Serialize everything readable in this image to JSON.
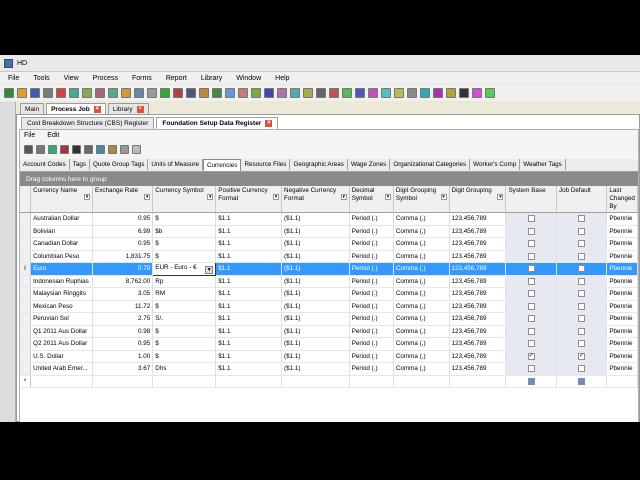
{
  "app": {
    "title": "HD"
  },
  "menu": [
    "File",
    "Tools",
    "View",
    "Process",
    "Forms",
    "Report",
    "Library",
    "Window",
    "Help"
  ],
  "doc_tabs": [
    {
      "label": "Main",
      "active": false
    },
    {
      "label": "Process Job",
      "active": true
    },
    {
      "label": "Library",
      "active": false
    }
  ],
  "sub_tabs": [
    {
      "label": "Cost Breakdown Structure (CBS) Register",
      "active": false
    },
    {
      "label": "Foundation Setup Data Register",
      "active": true
    }
  ],
  "panel_menu": [
    "File",
    "Edit"
  ],
  "category_tabs": [
    "Account Codes",
    "Tags",
    "Quote Group Tags",
    "Units of Measure",
    "Currencies",
    "Resource Files",
    "Geographic Areas",
    "Wage Zones",
    "Organizational Categories",
    "Worker's Comp",
    "Weather Tags"
  ],
  "active_category": "Currencies",
  "group_area_text": "Drag columns here to group",
  "columns": [
    "Currency Name",
    "Exchange Rate",
    "Currency Symbol",
    "Positive Currency Format",
    "Negative Currency Format",
    "Decimal Symbol",
    "Digit Grouping Symbol",
    "Digit Grouping",
    "System Base",
    "Job Default",
    "Last Changed By"
  ],
  "rows": [
    {
      "name": "Australian Dollar",
      "rate": "0.95",
      "symbol": "$",
      "pos": "$1.1",
      "neg": "($1.1)",
      "dec": "Period (.)",
      "grp": "Comma (,)",
      "digits": "123,456,789",
      "sys": false,
      "job": false,
      "by": "Pbennie"
    },
    {
      "name": "Bolivian",
      "rate": "6.99",
      "symbol": "$b",
      "pos": "$1.1",
      "neg": "($1.1)",
      "dec": "Period (.)",
      "grp": "Comma (,)",
      "digits": "123,456,789",
      "sys": false,
      "job": false,
      "by": "Pbennie"
    },
    {
      "name": "Canadian Dollar",
      "rate": "0.95",
      "symbol": "$",
      "pos": "$1.1",
      "neg": "($1.1)",
      "dec": "Period (.)",
      "grp": "Comma (,)",
      "digits": "123,456,789",
      "sys": false,
      "job": false,
      "by": "Pbennie"
    },
    {
      "name": "Columbian Peso",
      "rate": "1,831.75",
      "symbol": "$",
      "pos": "$1.1",
      "neg": "($1.1)",
      "dec": "Period (.)",
      "grp": "Comma (,)",
      "digits": "123,456,789",
      "sys": false,
      "job": false,
      "by": "Pbennie"
    },
    {
      "name": "Euro",
      "rate": "0.70",
      "symbol": "EUR - Euro - €",
      "pos": "$1.1",
      "neg": "($1.1)",
      "dec": "Period (.)",
      "grp": "Comma (,)",
      "digits": "123,456,789",
      "sys": false,
      "job": false,
      "by": "Pbennie",
      "selected": true
    },
    {
      "name": "Indonesian Ruphias",
      "rate": "8,762.00",
      "symbol": "Rp",
      "pos": "$1.1",
      "neg": "($1.1)",
      "dec": "Period (.)",
      "grp": "Comma (,)",
      "digits": "123,456,789",
      "sys": false,
      "job": false,
      "by": "Pbennie"
    },
    {
      "name": "Malaysian Ringgits",
      "rate": "3.05",
      "symbol": "RM",
      "pos": "$1.1",
      "neg": "($1.1)",
      "dec": "Period (.)",
      "grp": "Comma (,)",
      "digits": "123,456,789",
      "sys": false,
      "job": false,
      "by": "Pbennie"
    },
    {
      "name": "Mexican Peso",
      "rate": "11.72",
      "symbol": "$",
      "pos": "$1.1",
      "neg": "($1.1)",
      "dec": "Period (.)",
      "grp": "Comma (,)",
      "digits": "123,456,789",
      "sys": false,
      "job": false,
      "by": "Pbennie"
    },
    {
      "name": "Peruvian Sol",
      "rate": "2.75",
      "symbol": "S/.",
      "pos": "$1.1",
      "neg": "($1.1)",
      "dec": "Period (.)",
      "grp": "Comma (,)",
      "digits": "123,456,789",
      "sys": false,
      "job": false,
      "by": "Pbennie"
    },
    {
      "name": "Q1 2011 Aus Dollar",
      "rate": "0.98",
      "symbol": "$",
      "pos": "$1.1",
      "neg": "($1.1)",
      "dec": "Period (.)",
      "grp": "Comma (,)",
      "digits": "123,456,789",
      "sys": false,
      "job": false,
      "by": "Pbennie"
    },
    {
      "name": "Q2 2011 Aus Dollar",
      "rate": "0.95",
      "symbol": "$",
      "pos": "$1.1",
      "neg": "($1.1)",
      "dec": "Period (.)",
      "grp": "Comma (,)",
      "digits": "123,456,789",
      "sys": false,
      "job": false,
      "by": "Pbennie"
    },
    {
      "name": "U.S. Dollar",
      "rate": "1.00",
      "symbol": "$",
      "pos": "$1.1",
      "neg": "($1.1)",
      "dec": "Period (.)",
      "grp": "Comma (,)",
      "digits": "123,456,789",
      "sys": true,
      "job": true,
      "by": "Pbennie"
    },
    {
      "name": "United Arab Emer...",
      "rate": "3.67",
      "symbol": "Dhs",
      "pos": "$1.1",
      "neg": "($1.1)",
      "dec": "Period (.)",
      "grp": "Comma (,)",
      "digits": "123,456,789",
      "sys": false,
      "job": false,
      "by": "Pbennie"
    }
  ],
  "new_row_marker": "*",
  "selected_row_marker": "I"
}
